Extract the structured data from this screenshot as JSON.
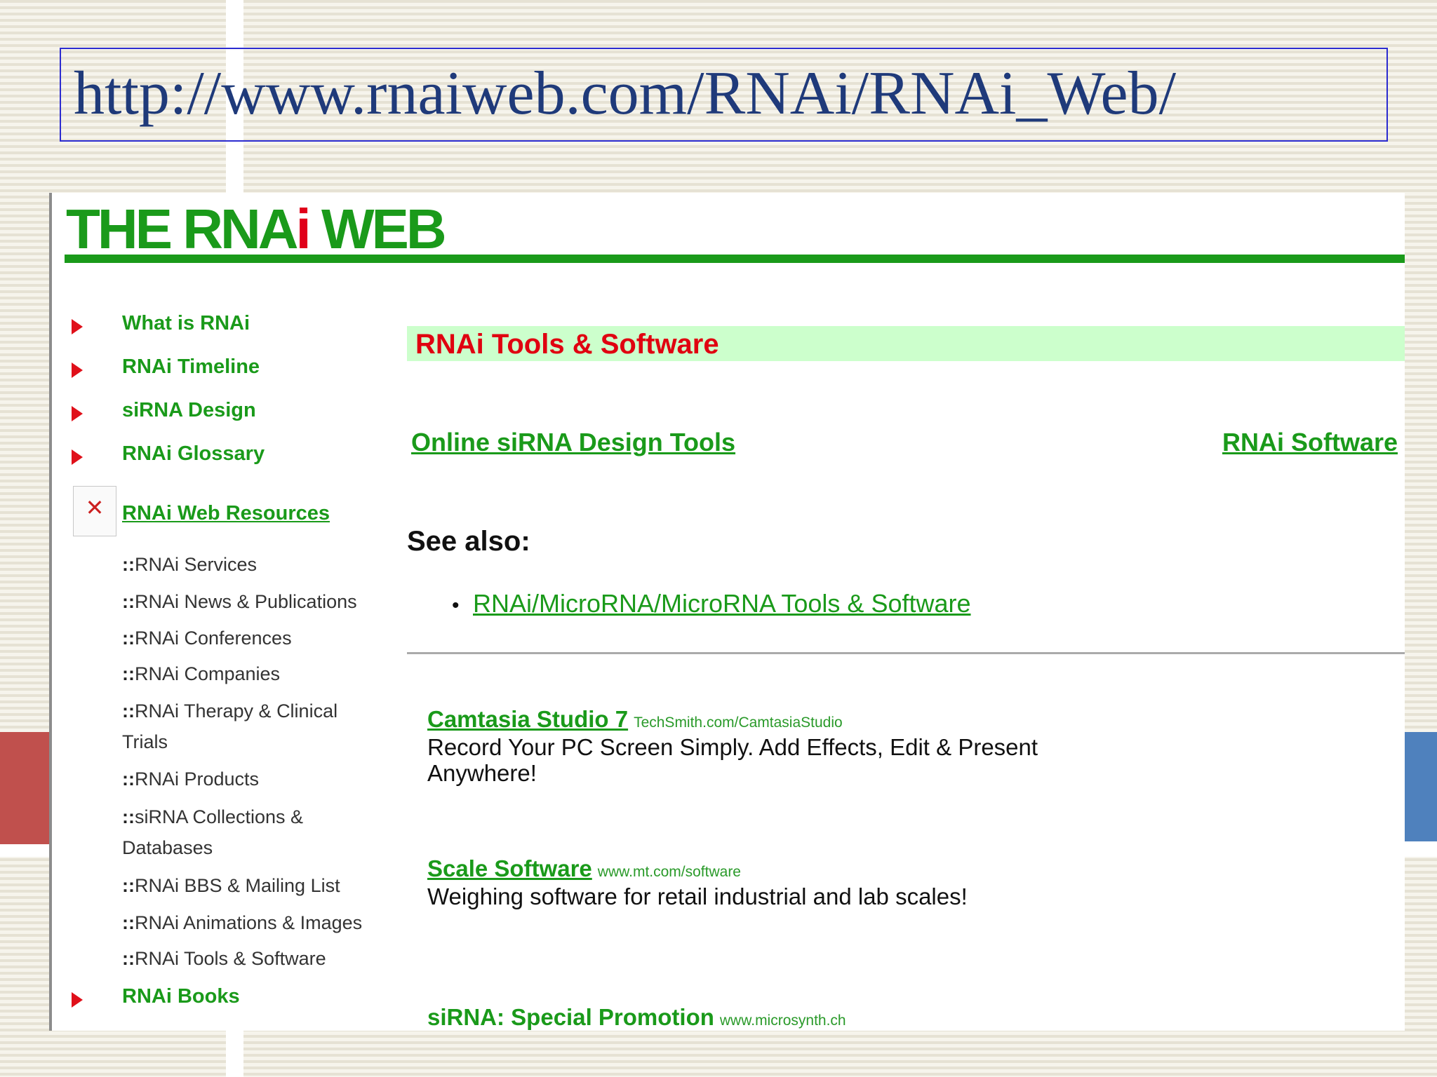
{
  "slide": {
    "url": "http://www.rnaiweb.com/RNAi/RNAi_Web/"
  },
  "site": {
    "logo_main": "THE RNA",
    "logo_i": "i",
    "logo_web": " WEB"
  },
  "nav": {
    "items": [
      {
        "label": "What is RNAi"
      },
      {
        "label": "RNAi Timeline"
      },
      {
        "label": "siRNA Design"
      },
      {
        "label": "RNAi Glossary"
      }
    ],
    "resources_label": "RNAi Web Resources",
    "books_label": "RNAi Books"
  },
  "sub": {
    "prefix": "::",
    "items": [
      {
        "label": "RNAi Services"
      },
      {
        "label": "RNAi News & Publications"
      },
      {
        "label": "RNAi Conferences"
      },
      {
        "label": "RNAi Companies"
      },
      {
        "label": "RNAi Therapy & Clinical Trials"
      },
      {
        "label": "RNAi Products"
      },
      {
        "label": "siRNA Collections & Databases"
      },
      {
        "label": "RNAi BBS & Mailing List"
      },
      {
        "label": "RNAi Animations & Images"
      },
      {
        "label": "RNAi Tools & Software"
      }
    ]
  },
  "main": {
    "section_title": "RNAi Tools & Software",
    "link_online": "Online siRNA Design Tools",
    "link_software": "RNAi Software",
    "see_also": "See also:",
    "bullet": "•",
    "see_also_link": "RNAi/MicroRNA/MicroRNA Tools & Software"
  },
  "ads": [
    {
      "title": "Camtasia Studio 7",
      "url": "TechSmith.com/CamtasiaStudio",
      "desc": "Record Your PC Screen Simply. Add Effects, Edit & Present Anywhere!"
    },
    {
      "title": "Scale Software",
      "url": "www.mt.com/software",
      "desc": "Weighing software for retail industrial and lab scales!"
    },
    {
      "title": "siRNA: Special Promotion",
      "url": "www.microsynth.ch",
      "desc": ""
    }
  ],
  "colors": {
    "green": "#1a9a1a",
    "red": "#e00010",
    "url_blue": "#1f3a7a",
    "banner": "#ccffcc"
  }
}
